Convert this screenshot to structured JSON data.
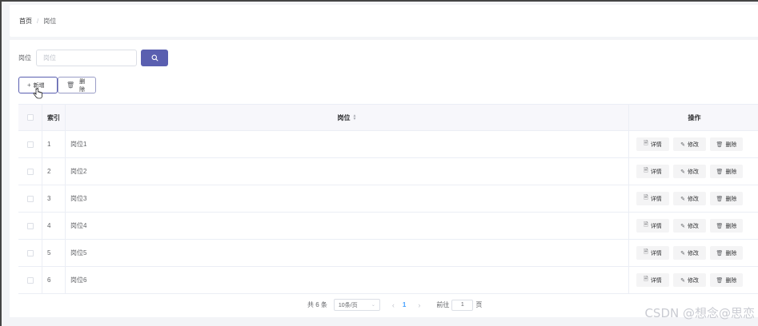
{
  "breadcrumb": {
    "home": "首页",
    "separator": "/",
    "current": "岗位"
  },
  "search": {
    "label": "岗位",
    "placeholder": "岗位"
  },
  "actions": {
    "add_label": "新增",
    "delete_label": "删除"
  },
  "table": {
    "headers": {
      "index": "索引",
      "name": "岗位",
      "ops": "操作"
    },
    "rows": [
      {
        "index": "1",
        "name": "岗位1"
      },
      {
        "index": "2",
        "name": "岗位2"
      },
      {
        "index": "3",
        "name": "岗位3"
      },
      {
        "index": "4",
        "name": "岗位4"
      },
      {
        "index": "5",
        "name": "岗位5"
      },
      {
        "index": "6",
        "name": "岗位6"
      }
    ],
    "row_ops": {
      "detail": "详情",
      "edit": "修改",
      "delete": "删除"
    }
  },
  "pagination": {
    "total_text": "共 6 条",
    "page_size": "10条/页",
    "current_page": "1",
    "goto_prefix": "前往",
    "goto_value": "1",
    "goto_suffix": "页"
  },
  "watermark": "CSDN @想念@思恋",
  "colors": {
    "primary": "#5a5fb0",
    "active_page": "#409eff"
  }
}
